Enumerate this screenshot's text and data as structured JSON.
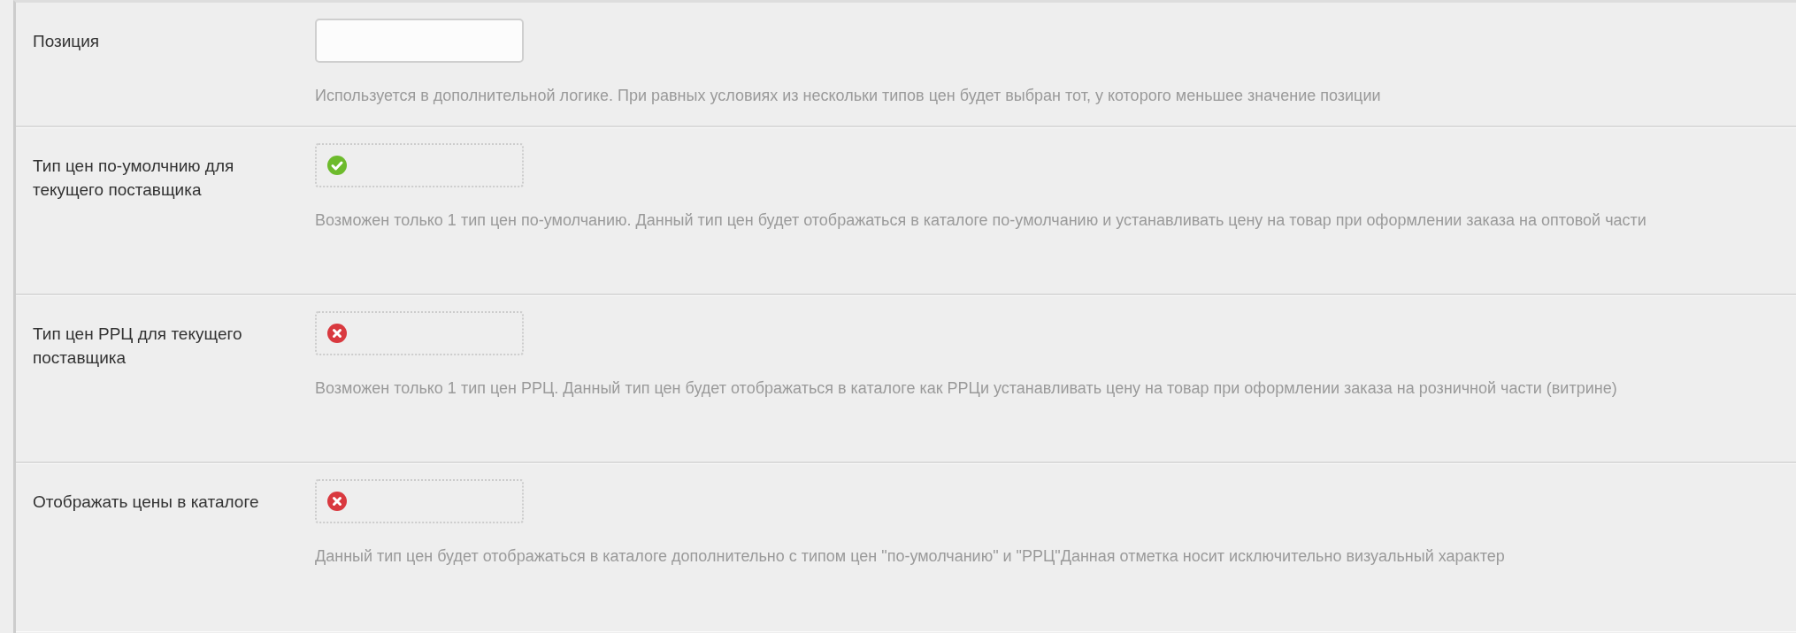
{
  "rows": [
    {
      "kind": "text_input",
      "label": "Позиция",
      "help": "Используется в дополнительной логике. При равных условиях из нескольки типов цен будет выбран тот, у которого меньшее значение позиции"
    },
    {
      "kind": "toggle",
      "label": "Тип цен по-умолчнию для текущего поставщика",
      "checked": true,
      "help": "Возможен только 1 тип цен по-умолчанию. Данный тип цен будет отображаться в каталоге по-умолчанию и устанавливать цену на товар при оформлении заказа на оптовой части"
    },
    {
      "kind": "toggle",
      "label": "Тип цен РРЦ для текущего поставщика",
      "checked": false,
      "help": "Возможен только 1 тип цен РРЦ. Данный тип цен будет отображаться в каталоге как РРЦи устанавливать цену на товар при оформлении заказа на розничной части (витрине)"
    },
    {
      "kind": "toggle",
      "label": "Отображать цены в каталоге",
      "checked": false,
      "help": "Данный тип цен будет отображаться в каталоге дополнительно с типом цен \"по-умолчанию\" и \"РРЦ\"Данная отметка носит исключительно визуальный характер"
    }
  ]
}
